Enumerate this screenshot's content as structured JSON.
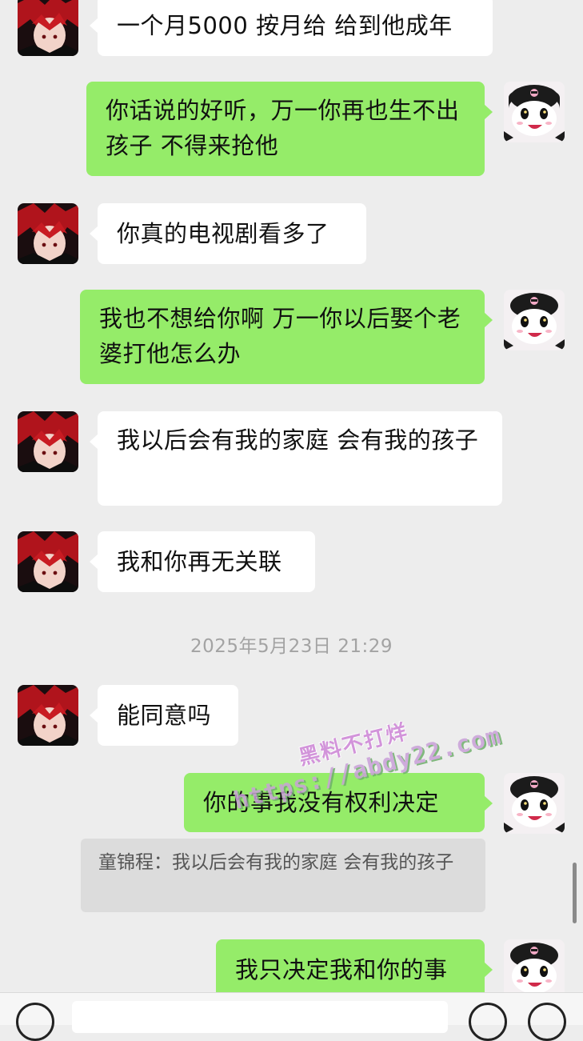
{
  "messages": [
    {
      "side": "in",
      "text": "一个月5000 按月给 给到他成年"
    },
    {
      "side": "out",
      "text": "你话说的好听，万一你再也生不出孩子 不得来抢他"
    },
    {
      "side": "in",
      "text": "你真的电视剧看多了"
    },
    {
      "side": "out",
      "text": "我也不想给你啊 万一你以后娶个老婆打他怎么办"
    },
    {
      "side": "in",
      "text": "我以后会有我的家庭 会有我的孩子"
    },
    {
      "side": "in",
      "text": "我和你再无关联"
    },
    {
      "side": "in",
      "text": "能同意吗"
    },
    {
      "side": "out",
      "text": "你的事我没有权利决定"
    },
    {
      "side": "out",
      "text": "我只决定我和你的事"
    }
  ],
  "timestamp": "2025年5月23日 21:29",
  "quote": {
    "text": "童锦程：我以后会有我的家庭 会有我的孩子"
  },
  "watermark": {
    "line1": "黑料不打烊",
    "line2": "https://abdy22.com"
  },
  "colors": {
    "background": "#ededed",
    "incoming_bubble": "#ffffff",
    "outgoing_bubble": "#95ec69"
  },
  "icons": {
    "contact_avatar": "red-haired-anime-avatar",
    "self_avatar": "kuromi-avatar",
    "voice": "voice-icon",
    "emoji": "emoji-icon",
    "more": "plus-icon"
  }
}
